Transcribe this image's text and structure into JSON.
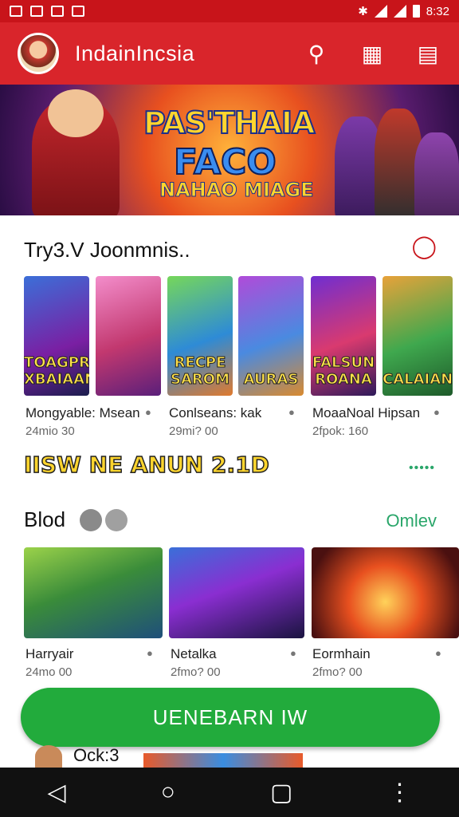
{
  "status": {
    "time": "8:32"
  },
  "appbar": {
    "title": "IndainIncsia"
  },
  "banner": {
    "line1": "PAS'THAIA",
    "line2": "FACO",
    "line3": "NAHAO MIAGE"
  },
  "section1": {
    "title": "Try3.V Joonmnis..",
    "cards": [
      {
        "caption": "TOAGPRIS XBAIAANQ"
      },
      {
        "caption": ""
      },
      {
        "caption": "RECPE SAROM"
      },
      {
        "caption": "AURAS"
      },
      {
        "caption": "FALSUN ROANA"
      },
      {
        "caption": "CALAIAN"
      }
    ],
    "items": [
      {
        "title": "Mongyable: Msean",
        "meta": "24mio 30"
      },
      {
        "title": "Conlseans: kak",
        "meta": "29mi? 00"
      },
      {
        "title": "MoaaNoal Hipsan",
        "meta": "2fpok: 160"
      }
    ]
  },
  "promo": {
    "text": "IISW NE ANUN 2.1D",
    "dots": "•••••"
  },
  "section2": {
    "title": "Blod",
    "more": "Omlev",
    "items": [
      {
        "title": "Harryair",
        "meta": "24mo 00"
      },
      {
        "title": "Netalka",
        "meta": "2fmo? 00"
      },
      {
        "title": "Eormhain",
        "meta": "2fmo? 00"
      }
    ]
  },
  "cta": {
    "label": "UENEBARN IW"
  },
  "peek": {
    "label": "Ock:3"
  }
}
